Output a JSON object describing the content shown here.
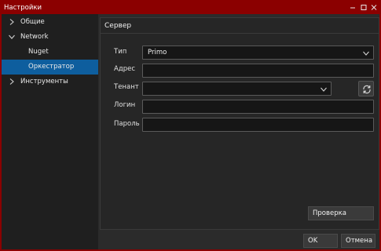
{
  "window": {
    "title": "Настройки",
    "minimize_icon": "minimize-icon",
    "maximize_icon": "maximize-icon",
    "close_icon": "close-icon",
    "frame_color": "#8b0000"
  },
  "sidebar": {
    "items": [
      {
        "label": "Общие",
        "expanded": false
      },
      {
        "label": "Network",
        "expanded": true
      },
      {
        "label": "Nuget"
      },
      {
        "label": "Оркестратор",
        "selected": true
      },
      {
        "label": "Инструменты",
        "expanded": false
      }
    ],
    "selected_color": "#0e5e9e"
  },
  "panel": {
    "title": "Сервер",
    "fields": {
      "type": {
        "label": "Тип",
        "value": "Primo"
      },
      "address": {
        "label": "Адрес",
        "value": ""
      },
      "tenant": {
        "label": "Тенант",
        "value": ""
      },
      "login": {
        "label": "Логин",
        "value": ""
      },
      "password": {
        "label": "Пароль",
        "value": ""
      }
    },
    "refresh_icon": "refresh-icon",
    "check_button": "Проверка"
  },
  "footer": {
    "ok_button": "OK",
    "cancel_button": "Отмена"
  }
}
